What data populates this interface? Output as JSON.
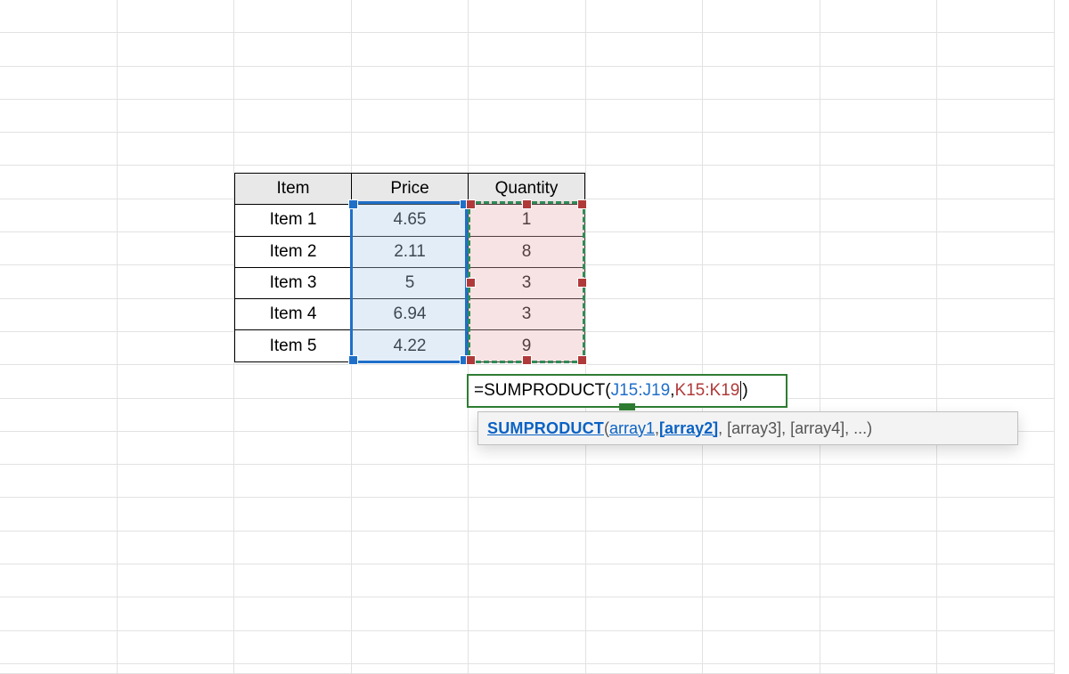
{
  "table": {
    "headers": {
      "item": "Item",
      "price": "Price",
      "quantity": "Quantity"
    },
    "rows": [
      {
        "item": "Item 1",
        "price": "4.65",
        "quantity": "1"
      },
      {
        "item": "Item 2",
        "price": "2.11",
        "quantity": "8"
      },
      {
        "item": "Item 3",
        "price": "5",
        "quantity": "3"
      },
      {
        "item": "Item 4",
        "price": "6.94",
        "quantity": "3"
      },
      {
        "item": "Item 5",
        "price": "4.22",
        "quantity": "9"
      }
    ]
  },
  "formula": {
    "prefix": "=",
    "fn": "SUMPRODUCT",
    "open": "(",
    "arg1": "J15:J19",
    "sep": ",",
    "arg2": "K15:K19",
    "close": ")"
  },
  "hint": {
    "fn": "SUMPRODUCT",
    "open": "(",
    "a1": "array1",
    "sep1": ", ",
    "a2_open": "[",
    "a2": "array2",
    "a2_close": "]",
    "rest": ", [array3], [array4], ...)"
  },
  "chart_data": {
    "type": "table",
    "columns": [
      "Item",
      "Price",
      "Quantity"
    ],
    "rows": [
      [
        "Item 1",
        4.65,
        1
      ],
      [
        "Item 2",
        2.11,
        8
      ],
      [
        "Item 3",
        5,
        3
      ],
      [
        "Item 4",
        6.94,
        3
      ],
      [
        "Item 5",
        4.22,
        9
      ]
    ]
  }
}
